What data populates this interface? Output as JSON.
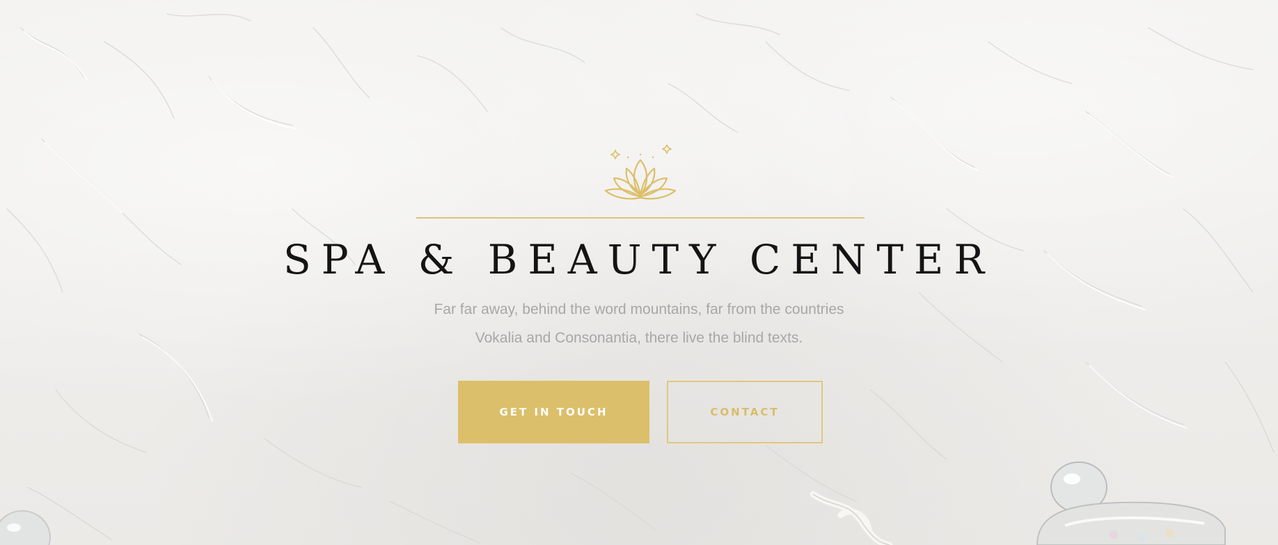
{
  "hero": {
    "title": "SPA & BEAUTY CENTER",
    "subtitle_line1": "Far far away, behind the word mountains, far from the countries",
    "subtitle_line2": "Vokalia and Consonantia, there live the blind texts.",
    "primary_button": "GET IN TOUCH",
    "secondary_button": "CONTACT",
    "logo_icon": "lotus-icon"
  },
  "colors": {
    "accent": "#dcbf6a",
    "title": "#141414",
    "subtitle": "#a7a7a7",
    "background": "#f0efed"
  }
}
